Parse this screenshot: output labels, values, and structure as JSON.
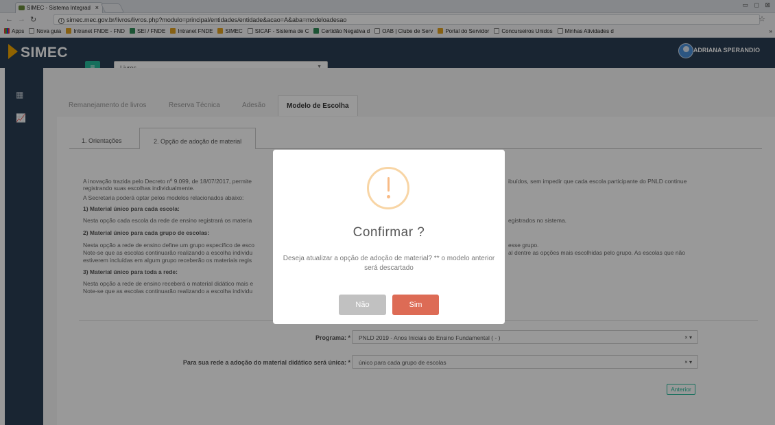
{
  "browser": {
    "tab_title": "SIMEC - Sistema Integrad",
    "tab_close": "×",
    "window_buttons": "▭ ◻ ⊠",
    "url": "simec.mec.gov.br/livros/livros.php?modulo=principal/entidades/entidade&acao=A&aba=modeloadesao",
    "bookmarks": [
      {
        "label": "Apps",
        "icon": "apps-icon"
      },
      {
        "label": "Nova guia",
        "icon": "page-icon"
      },
      {
        "label": "Intranet FNDE - FND",
        "icon": "fnde-icon"
      },
      {
        "label": "SEI / FNDE",
        "icon": "sei-icon"
      },
      {
        "label": "Intranet FNDE",
        "icon": "fnde-icon"
      },
      {
        "label": "SIMEC",
        "icon": "simec-icon"
      },
      {
        "label": "SICAF - Sistema de C",
        "icon": "page-icon"
      },
      {
        "label": "Certidão Negativa d",
        "icon": "certidao-icon"
      },
      {
        "label": "OAB | Clube de Serv",
        "icon": "page-icon"
      },
      {
        "label": "Portal do Servidor",
        "icon": "fnde-icon"
      },
      {
        "label": "Concurseiros Unidos",
        "icon": "page-icon"
      },
      {
        "label": "Minhas Atividades d",
        "icon": "page-icon"
      }
    ],
    "more": "»"
  },
  "header": {
    "logo": "SIMEC",
    "module_select": "Livros",
    "user_name": "ADRIANA SPERANDIO"
  },
  "tabs": [
    {
      "label": "Remanejamento de livros"
    },
    {
      "label": "Reserva Técnica"
    },
    {
      "label": "Adesão"
    },
    {
      "label": "Modelo de Escolha"
    }
  ],
  "subtabs": [
    {
      "label": "1. Orientações"
    },
    {
      "label": "2. Opção de adoção de material"
    }
  ],
  "body": {
    "p1a": "A inovação trazida pelo Decreto nº 9.099, de 18/07/2017, permite",
    "p1b": "ibuídos, sem impedir que cada escola participante do PNLD continue",
    "p1c": "registrando suas escolhas individualmente.",
    "p2": "A Secretaria poderá optar pelos modelos relacionados abaixo:",
    "h1": "1) Material único para cada escola:",
    "p3a": "Nesta opção cada escola da rede de ensino registrará os materia",
    "p3b": "egistrados no sistema.",
    "h2": "2) Material único para cada grupo de escolas:",
    "p4a": "Nesta opção a rede de ensino define um grupo específico de esco",
    "p4b": "esse grupo.",
    "p5a": "Note-se que as escolas continuarão realizando a escolha individu",
    "p5b": "al dentre as opções mais escolhidas pelo grupo. As escolas que não",
    "p6": "estiverem incluídas em algum grupo receberão os materiais regis",
    "h3": "3) Material único para toda a rede:",
    "p7": "Nesta opção a rede de ensino receberá o material didático mais e",
    "p8": "Note-se que as escolas continuarão realizando a escolha individu"
  },
  "form": {
    "programa_label": "Programa: *",
    "programa_value": "PNLD 2019 - Anos Iniciais do Ensino Fundamental ( - )",
    "adocao_label": "Para sua rede a adoção do material didático será única: *",
    "adocao_value": "único para cada grupo de escolas",
    "select_controls": "× ▾",
    "anterior_button": "Anterior"
  },
  "modal": {
    "title": "Confirmar ?",
    "text": "Deseja atualizar a opção de adoção de material? ** o modelo anterior será descartado",
    "no_button": "Não",
    "yes_button": "Sim",
    "no_color": "#c1c1c1",
    "yes_color": "#dd6b55"
  },
  "colors": {
    "sidebar": "#2a3f54",
    "accent": "#26b99a"
  }
}
